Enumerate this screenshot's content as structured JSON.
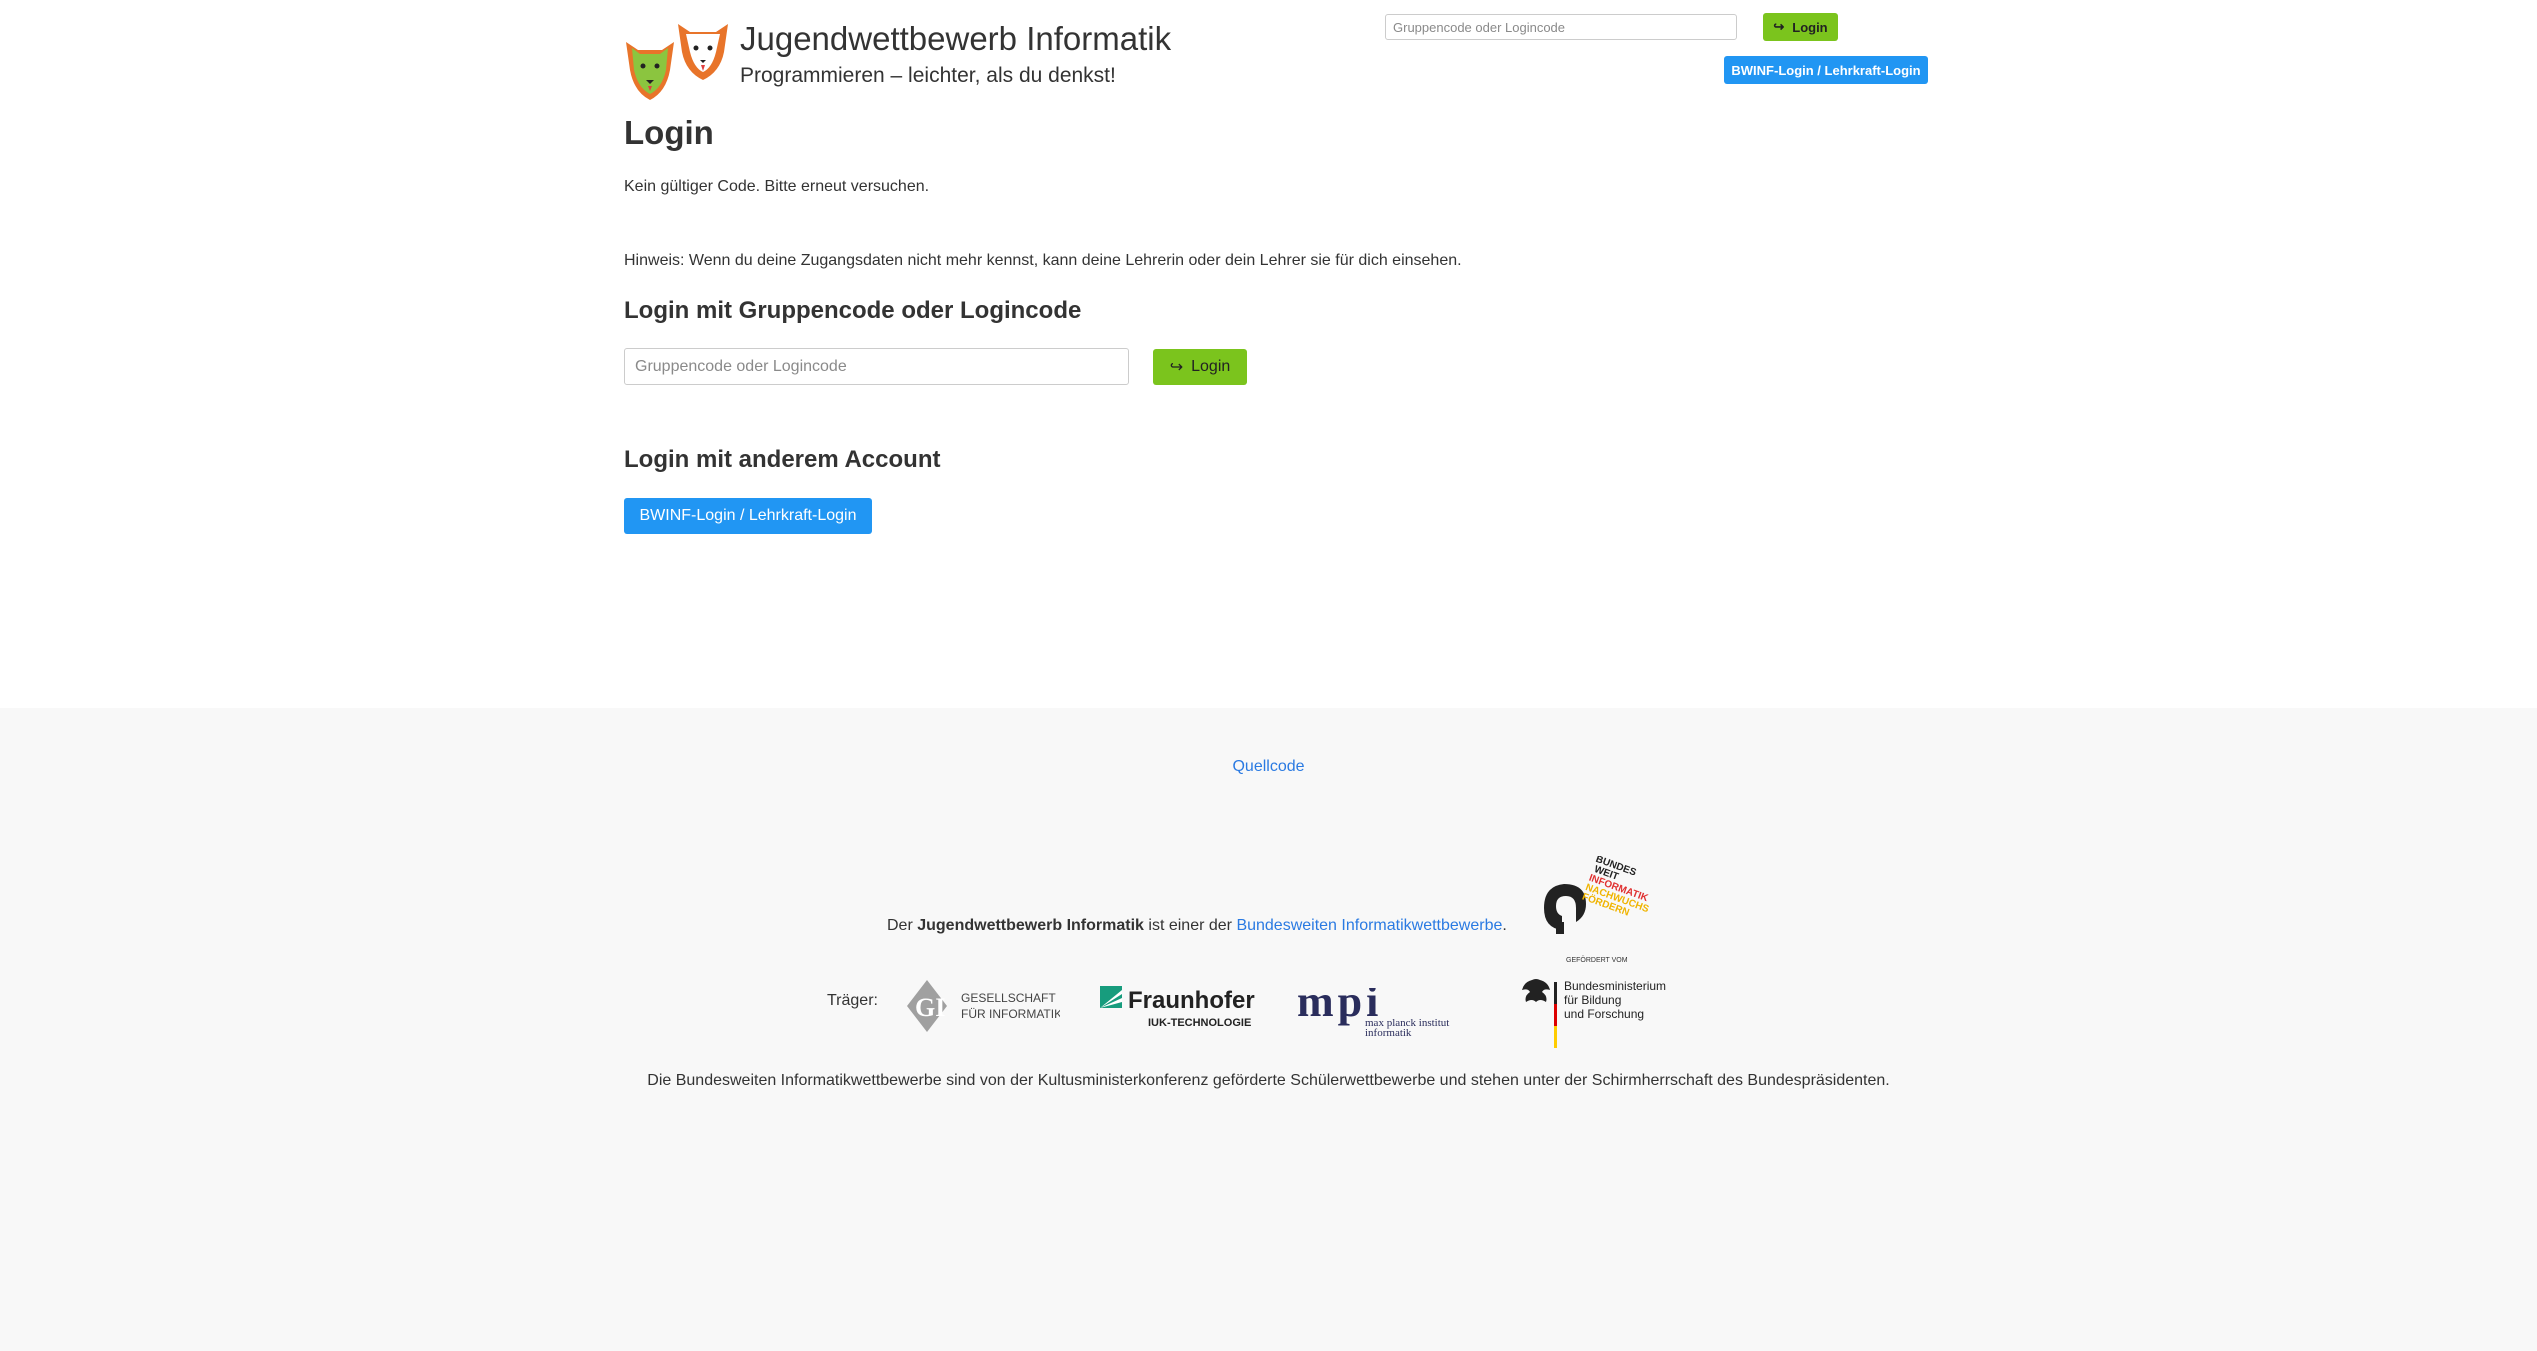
{
  "header": {
    "title": "Jugendwettbewerb Informatik",
    "subtitle": "Programmieren – leichter, als du denkst!",
    "code_placeholder": "Gruppencode oder Logincode",
    "login_label": "Login",
    "bwinf_login_label": "BWINF-Login / Lehrkraft-Login"
  },
  "main": {
    "title": "Login",
    "error_message": "Kein gültiger Code. Bitte erneut versuchen.",
    "hint": "Hinweis: Wenn du deine Zugangsdaten nicht mehr kennst, kann deine Lehrerin oder dein Lehrer sie für dich einsehen.",
    "code_section_title": "Login mit Gruppencode oder Logincode",
    "code_placeholder": "Gruppencode oder Logincode",
    "login_label": "Login",
    "other_section_title": "Login mit anderem Account",
    "bwinf_login_label": "BWINF-Login / Lehrkraft-Login"
  },
  "footer": {
    "source_link": "Quellcode",
    "line_prefix": "Der",
    "line_bold": "Jugendwettbewerb Informatik",
    "line_middle": "ist einer der",
    "line_link": "Bundesweiten Informatikwettbewerbe",
    "line_suffix": ".",
    "traeger_label": "Träger:",
    "bottom_text": "Die Bundesweiten Informatikwettbewerbe sind von der Kultusministerkonferenz geförderte Schülerwettbewerbe und stehen unter der Schirmherrschaft des Bundespräsidenten.",
    "logos": {
      "bwinf": [
        "BUNDES",
        "WEIT",
        "INFORMATIK",
        "NACHWUCHS",
        "FÖRDERN"
      ],
      "gefoerdert": "GEFÖRDERT VOM",
      "gi": [
        "GESELLSCHAFT",
        "FÜR INFORMATIK"
      ],
      "fraunhofer": [
        "Fraunhofer",
        "IUK-TECHNOLOGIE"
      ],
      "mpi": [
        "max planck institut",
        "informatik"
      ],
      "bmbf": [
        "Bundesministerium",
        "für Bildung",
        "und Forschung"
      ]
    }
  },
  "colors": {
    "green_button": "#7bc41d",
    "blue_button": "#2196f3",
    "link": "#2a7ae2",
    "footer_bg": "#f8f8f8"
  },
  "icons": [
    "fox-logo-icon",
    "login-arrow-icon"
  ]
}
